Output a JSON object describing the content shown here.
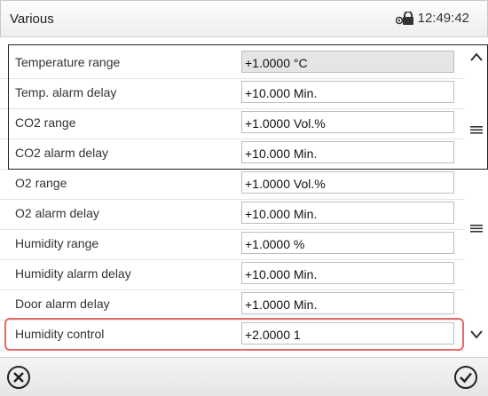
{
  "header": {
    "title": "Various",
    "time": "12:49:42"
  },
  "rows": [
    {
      "label": "Temperature range",
      "value": "+1.0000 °C",
      "readonly": true
    },
    {
      "label": "Temp. alarm delay",
      "value": "+10.000 Min."
    },
    {
      "label": "CO2 range",
      "value": "+1.0000 Vol.%"
    },
    {
      "label": "CO2 alarm delay",
      "value": "+10.000 Min."
    },
    {
      "label": "O2 range",
      "value": "+1.0000 Vol.%"
    },
    {
      "label": "O2 alarm delay",
      "value": "+10.000 Min."
    },
    {
      "label": "Humidity range",
      "value": "+1.0000 %"
    },
    {
      "label": "Humidity alarm delay",
      "value": "+10.000 Min."
    },
    {
      "label": "Door alarm delay",
      "value": "+1.0000 Min."
    },
    {
      "label": "Humidity control",
      "value": "+2.0000 1"
    }
  ],
  "icons": {
    "lock": "lock-icon",
    "scroll_up": "chevron-up-icon",
    "scroll_mid": "menu-lines-icon",
    "scroll_down": "chevron-down-icon",
    "cancel": "cancel-x-icon",
    "confirm": "checkmark-icon"
  },
  "colors": {
    "highlight": "#e66a6a",
    "readonly_field": "#e5e5e5"
  }
}
